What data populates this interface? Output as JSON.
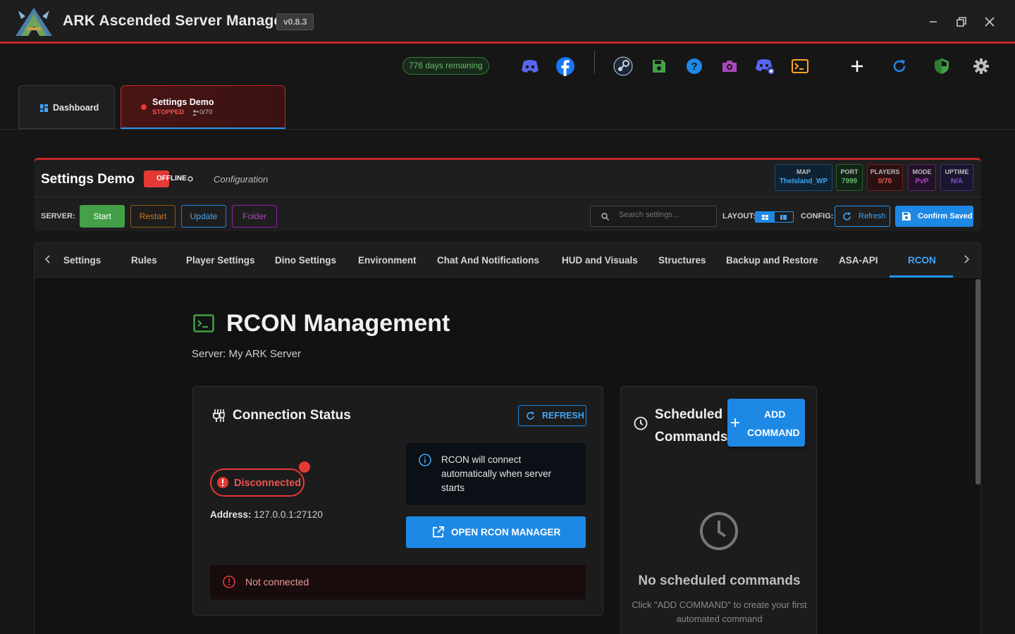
{
  "app": {
    "title": "ARK Ascended Server Manager",
    "version": "v0.8.3"
  },
  "toolbar": {
    "days_remaining": "776 days remaining",
    "icons": [
      "discord-icon",
      "facebook-icon",
      "steam-icon",
      "save-icon",
      "help-icon",
      "camera-icon",
      "discord-bot-icon",
      "terminal-icon",
      "add-icon",
      "refresh-icon",
      "shield-icon",
      "gear-icon"
    ]
  },
  "tabs": {
    "dashboard": "Dashboard",
    "server_name": "Settings Demo",
    "server_status": "STOPPED",
    "server_players": "0/70"
  },
  "server_panel": {
    "title": "Settings Demo",
    "status": "OFFLINE",
    "subtitle": "Configuration",
    "stats": [
      {
        "key": "MAP",
        "value": "TheIsland_WP"
      },
      {
        "key": "PORT",
        "value": "7999"
      },
      {
        "key": "PLAYERS",
        "value": "0/70"
      },
      {
        "key": "MODE",
        "value": "PvP"
      },
      {
        "key": "UPTIME",
        "value": "N/A"
      }
    ],
    "server_label": "SERVER:",
    "buttons": {
      "start": "Start",
      "restart": "Restart",
      "update": "Update",
      "folder": "Folder"
    },
    "search_placeholder": "Search settings...",
    "layout_label": "LAYOUT:",
    "config_label": "CONFIG:",
    "refresh": "Refresh",
    "confirm": "Confirm Saved"
  },
  "nav_tabs": [
    "Settings",
    "Rules",
    "Player Settings",
    "Dino Settings",
    "Environment",
    "Chat And Notifications",
    "HUD and Visuals",
    "Structures",
    "Backup and Restore",
    "ASA-API",
    "RCON"
  ],
  "active_tab": "RCON",
  "rcon": {
    "title": "RCON Management",
    "server": "Server: My ARK Server",
    "connection": {
      "title": "Connection Status",
      "refresh": "REFRESH",
      "status": "Disconnected",
      "address_label": "Address:",
      "address": "127.0.0.1:27120",
      "info": "RCON will connect automatically when server starts",
      "open_button": "OPEN RCON MANAGER",
      "error": "Not connected"
    },
    "scheduled": {
      "title_line1": "Scheduled",
      "title_line2": "Commands",
      "add_line1": "ADD",
      "add_line2": "COMMAND",
      "empty_title": "No scheduled commands",
      "empty_sub": "Click \"ADD COMMAND\" to create your first automated command"
    }
  },
  "colors": {
    "accent": "#1e88e5",
    "danger": "#e53935",
    "success": "#43a047"
  }
}
